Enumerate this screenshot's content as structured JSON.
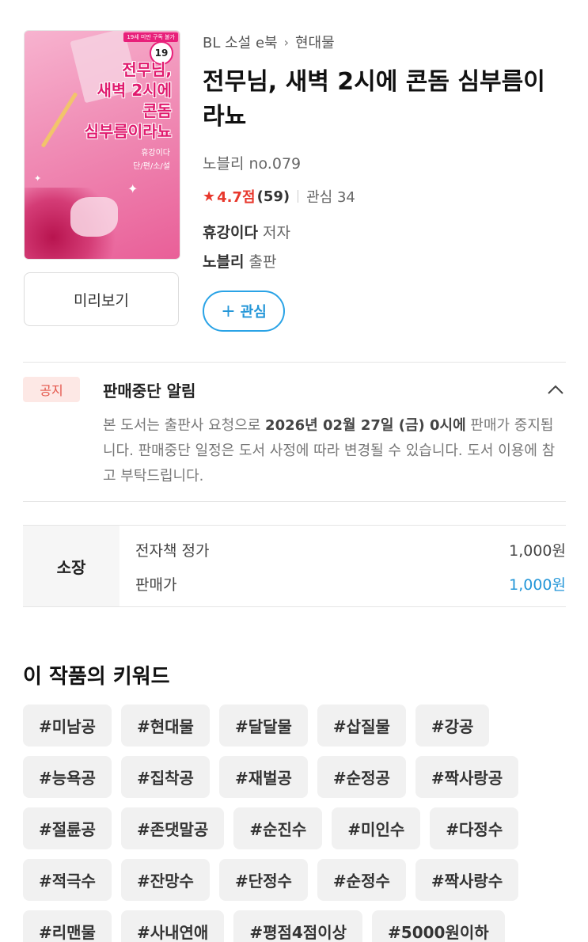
{
  "book": {
    "cover": {
      "age_badge": "19",
      "ban_label": "19세 미만 구독 불가",
      "title_lines": [
        "전무님,",
        "새벽 2시에",
        "콘돔",
        "심부름이라뇨"
      ],
      "author_text": "휴강이다",
      "series_text": "단/편/소/설"
    },
    "preview_label": "미리보기",
    "breadcrumb": {
      "category": "BL 소설 e북",
      "subcategory": "현대물"
    },
    "title": "전무님, 새벽 2시에 콘돔 심부름이라뇨",
    "series": "노블리 no.079",
    "rating": {
      "score": "4.7점",
      "count": "(59)",
      "interest": "관심 34"
    },
    "author": {
      "name": "휴강이다",
      "role": "저자"
    },
    "publisher": {
      "name": "노블리",
      "role": "출판"
    },
    "follow_label": "관심"
  },
  "notice": {
    "badge": "공지",
    "title": "판매중단 알림",
    "body_pre": "본 도서는 출판사 요청으로 ",
    "body_bold": "2026년 02월 27일 (금) 0시에",
    "body_post": " 판매가 중지됩니다. 판매중단 일정은 도서 사정에 따라 변경될 수 있습니다. 도서 이용에 참고 부탁드립니다."
  },
  "price": {
    "type_label": "소장",
    "list_label": "전자책 정가",
    "list_value": "1,000원",
    "sale_label": "판매가",
    "sale_value": "1,000원"
  },
  "keywords": {
    "heading": "이 작품의 키워드",
    "items": [
      "#미남공",
      "#현대물",
      "#달달물",
      "#삽질물",
      "#강공",
      "#능욕공",
      "#집착공",
      "#재벌공",
      "#순정공",
      "#짝사랑공",
      "#절륜공",
      "#존댓말공",
      "#순진수",
      "#미인수",
      "#다정수",
      "#적극수",
      "#잔망수",
      "#단정수",
      "#순정수",
      "#짝사랑수",
      "#리맨물",
      "#사내연애",
      "#평점4점이상",
      "#5000원이하"
    ]
  },
  "colors": {
    "accent_blue": "#2396d8",
    "rating_red": "#e8372c",
    "notice_red": "#e4564a"
  }
}
